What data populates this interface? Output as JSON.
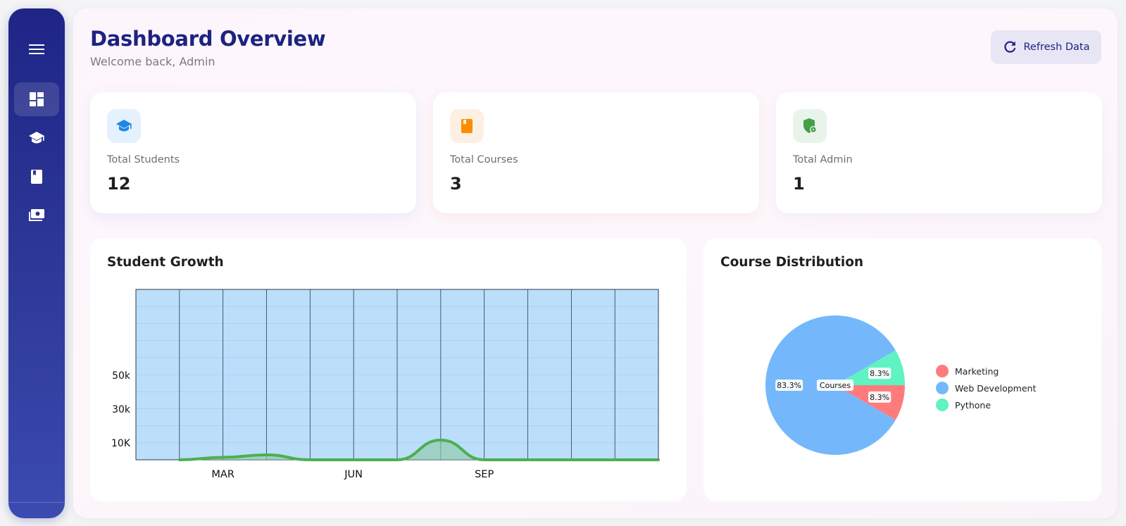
{
  "header": {
    "title": "Dashboard Overview",
    "subtitle": "Welcome back, Admin",
    "refresh_label": "Refresh Data"
  },
  "sidebar": {
    "items": [
      {
        "icon": "dashboard-icon",
        "active": true
      },
      {
        "icon": "graduation-cap-icon",
        "active": false
      },
      {
        "icon": "book-icon",
        "active": false
      },
      {
        "icon": "payments-icon",
        "active": false
      }
    ]
  },
  "stats": [
    {
      "label": "Total Students",
      "value": "12",
      "icon": "graduation-cap-icon",
      "color": "#1e88e5",
      "bg": "#e5f1fd"
    },
    {
      "label": "Total Courses",
      "value": "3",
      "icon": "book-icon",
      "color": "#fb8c00",
      "bg": "#fdf0e3"
    },
    {
      "label": "Total Admin",
      "value": "1",
      "icon": "admin-shield-icon",
      "color": "#43a047",
      "bg": "#e8f4e9"
    }
  ],
  "growth": {
    "title": "Student Growth"
  },
  "distribution": {
    "title": "Course Distribution"
  },
  "chart_data": [
    {
      "type": "area",
      "title": "Student Growth",
      "x_tick_labels": [
        "MAR",
        "JUN",
        "SEP"
      ],
      "y_tick_labels": [
        "10K",
        "30k",
        "50k"
      ],
      "months": 12,
      "values": [
        0,
        1,
        2,
        0,
        0,
        0,
        8,
        0,
        0,
        0,
        0,
        0
      ],
      "line_color": "#4caf50",
      "fill_color": "#bbdefb"
    },
    {
      "type": "pie",
      "title": "Course Distribution",
      "center_label": "Courses",
      "slices": [
        {
          "label": "Marketing",
          "value": 8.3,
          "display": "8.3%",
          "color": "#ff7b7b"
        },
        {
          "label": "Web Development",
          "value": 83.3,
          "display": "83.3%",
          "color": "#74b8fb"
        },
        {
          "label": "Pythone",
          "value": 8.3,
          "display": "8.3%",
          "color": "#5ff2c3"
        }
      ],
      "legend_position": "right"
    }
  ]
}
